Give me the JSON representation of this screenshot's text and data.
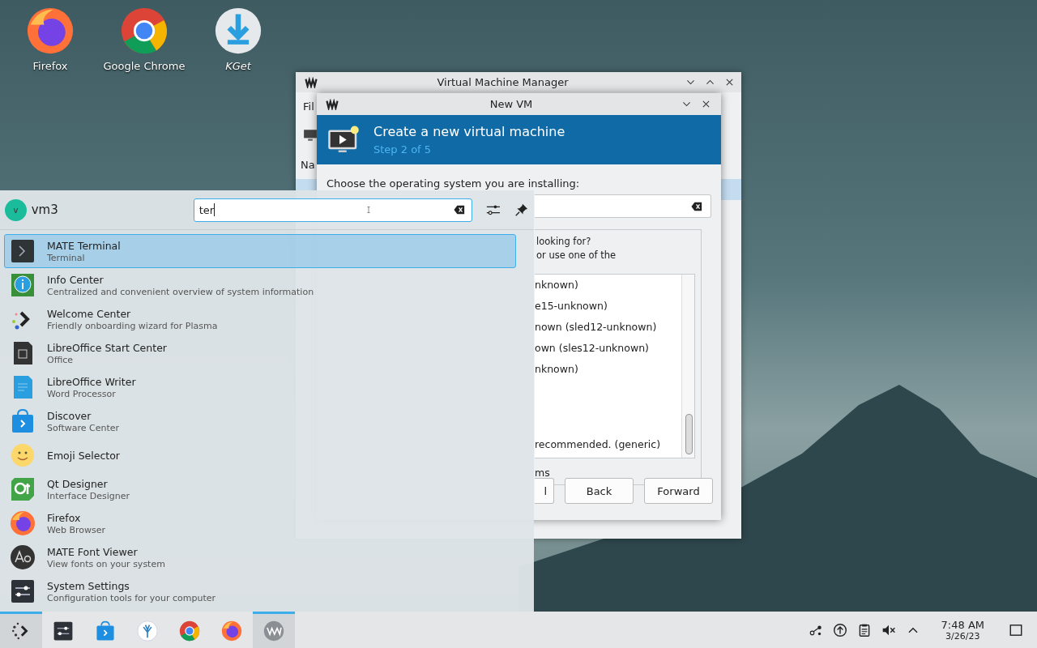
{
  "desktop_icons": [
    {
      "label": "Firefox",
      "kind": "firefox",
      "italic": false
    },
    {
      "label": "Google Chrome",
      "kind": "chrome",
      "italic": false
    },
    {
      "label": "KGet",
      "kind": "kget",
      "italic": true
    }
  ],
  "manager_window": {
    "title": "Virtual Machine Manager",
    "menu_fragment": "Fil",
    "column_fragment": "Na"
  },
  "new_vm_dialog": {
    "title": "New VM",
    "heading": "Create a new virtual machine",
    "step": "Step 2 of 5",
    "prompt": "Choose the operating system you are installing:",
    "info_fragments": [
      "looking for?",
      "or use one of the"
    ],
    "os_fragments": [
      "nknown)",
      "e15-unknown)",
      "nown (sled12-unknown)",
      "own (sles12-unknown)",
      "nknown)",
      "recommended. (generic)"
    ],
    "checkbox_fragment": "ms",
    "buttons": [
      {
        "label": "l",
        "kind": "partial"
      },
      {
        "label": "Back",
        "kind": "full"
      },
      {
        "label": "Forward",
        "kind": "full"
      }
    ]
  },
  "launcher": {
    "user": "vm3",
    "avatar_letter": "v",
    "search": {
      "value": "ter"
    },
    "results": [
      {
        "name": "MATE Terminal",
        "description": "Terminal",
        "kind": "terminal",
        "selected": true
      },
      {
        "name": "Info Center",
        "description": "Centralized and convenient overview of system information",
        "kind": "info",
        "selected": false
      },
      {
        "name": "Welcome Center",
        "description": "Friendly onboarding wizard for Plasma",
        "kind": "welcome",
        "selected": false
      },
      {
        "name": "LibreOffice Start Center",
        "description": "Office",
        "kind": "office",
        "selected": false
      },
      {
        "name": "LibreOffice Writer",
        "description": "Word Processor",
        "kind": "writer",
        "selected": false
      },
      {
        "name": "Discover",
        "description": "Software Center",
        "kind": "discover",
        "selected": false
      },
      {
        "name": "Emoji Selector",
        "kind": "emoji",
        "selected": false
      },
      {
        "name": "Qt Designer",
        "description": "Interface Designer",
        "kind": "qt",
        "selected": false
      },
      {
        "name": "Firefox",
        "description": "Web Browser",
        "kind": "firefox",
        "selected": false
      },
      {
        "name": "MATE Font Viewer",
        "description": "View fonts on your system",
        "kind": "font",
        "selected": false
      },
      {
        "name": "System Settings",
        "description": "Configuration tools for your computer",
        "kind": "settings",
        "selected": false
      }
    ]
  },
  "taskbar": {
    "items": [
      {
        "kind": "launcher",
        "selected": true
      },
      {
        "kind": "settings",
        "selected": false
      },
      {
        "kind": "discover",
        "selected": false
      },
      {
        "kind": "flower",
        "selected": false
      },
      {
        "kind": "chrome",
        "selected": false
      },
      {
        "kind": "firefox",
        "selected": false
      },
      {
        "kind": "vm",
        "selected": true
      }
    ],
    "tray": [
      {
        "kind": "network"
      },
      {
        "kind": "updates"
      },
      {
        "kind": "clipboard"
      },
      {
        "kind": "muted"
      },
      {
        "kind": "caret"
      }
    ],
    "clock": {
      "time": "7:48 AM",
      "date": "3/26/23"
    }
  }
}
